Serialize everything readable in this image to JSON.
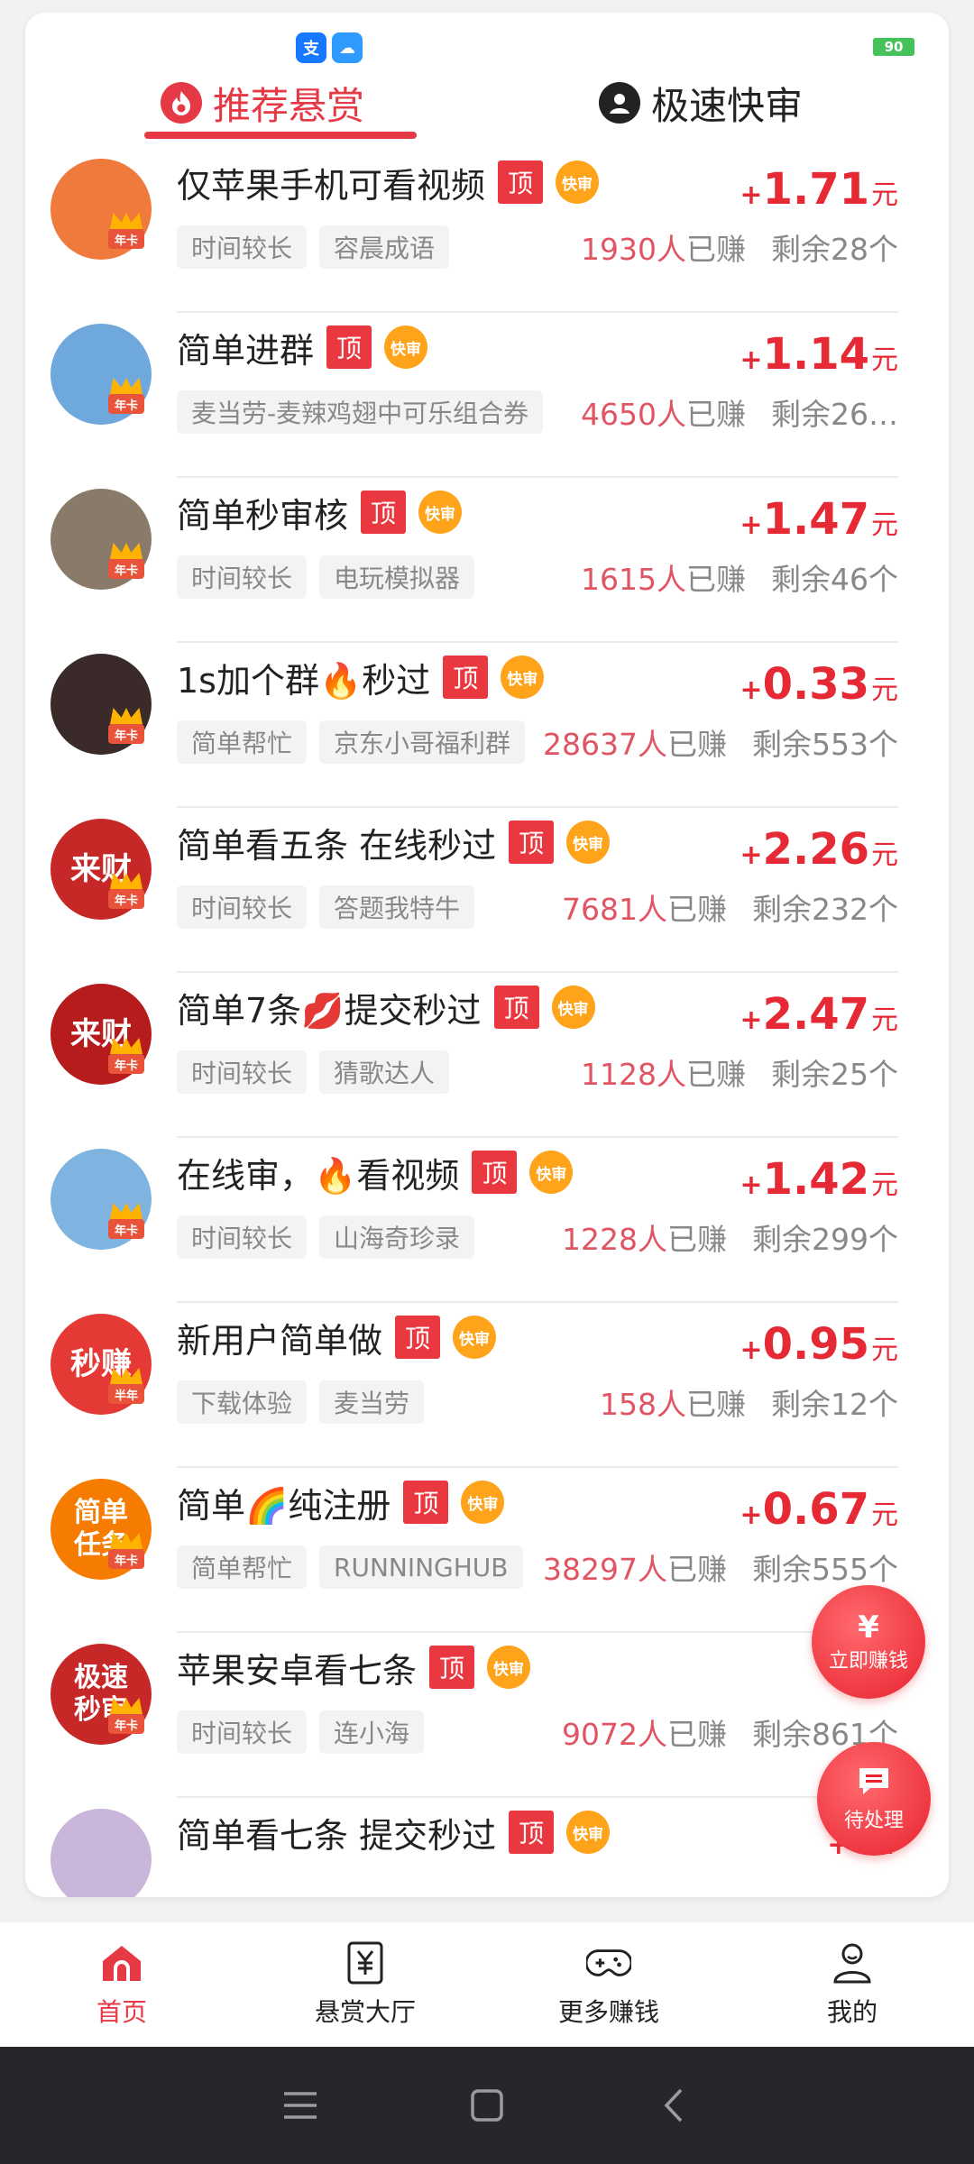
{
  "status_bar": {
    "battery": "90",
    "mini_apps": [
      "alipay-icon",
      "cloud-icon"
    ]
  },
  "tabs": [
    {
      "label": "推荐悬赏",
      "icon": "fire-icon",
      "active": true
    },
    {
      "label": "极速快审",
      "icon": "user-circle-icon",
      "active": false
    }
  ],
  "badges": {
    "top": "顶",
    "fast": "快审",
    "year_card": "年卡",
    "half_year_card": "半年"
  },
  "tasks": [
    {
      "title": "仅苹果手机可看视频",
      "price_sign": "+",
      "price": "1.71",
      "unit": "元",
      "tags": [
        "时间较长",
        "容晨成语"
      ],
      "earned_count": "1930人",
      "earned_label": "已赚",
      "remaining": "剩余28个",
      "avatar_text": "",
      "avatar_color": "#f07a3c"
    },
    {
      "title": "简单进群",
      "price_sign": "+",
      "price": "1.14",
      "unit": "元",
      "tags": [
        "麦当劳-麦辣鸡翅中可乐组合券"
      ],
      "earned_count": "4650人",
      "earned_label": "已赚",
      "remaining": "剩余26…",
      "avatar_text": "",
      "avatar_color": "#6fa8dc"
    },
    {
      "title": "简单秒审核",
      "price_sign": "+",
      "price": "1.47",
      "unit": "元",
      "tags": [
        "时间较长",
        "电玩模拟器"
      ],
      "earned_count": "1615人",
      "earned_label": "已赚",
      "remaining": "剩余46个",
      "avatar_text": "",
      "avatar_color": "#8a7a6a"
    },
    {
      "title": "1s加个群🔥秒过",
      "price_sign": "+",
      "price": "0.33",
      "unit": "元",
      "tags": [
        "简单帮忙",
        "京东小哥福利群"
      ],
      "earned_count": "28637人",
      "earned_label": "已赚",
      "remaining": "剩余553个",
      "avatar_text": "",
      "avatar_color": "#3a2a2a"
    },
    {
      "title": "简单看五条 在线秒过",
      "price_sign": "+",
      "price": "2.26",
      "unit": "元",
      "tags": [
        "时间较长",
        "答题我特牛"
      ],
      "earned_count": "7681人",
      "earned_label": "已赚",
      "remaining": "剩余232个",
      "avatar_text": "来财",
      "avatar_color": "#c62828"
    },
    {
      "title": "简单7条💋提交秒过",
      "price_sign": "+",
      "price": "2.47",
      "unit": "元",
      "tags": [
        "时间较长",
        "猜歌达人"
      ],
      "earned_count": "1128人",
      "earned_label": "已赚",
      "remaining": "剩余25个",
      "avatar_text": "来财",
      "avatar_color": "#b71c1c"
    },
    {
      "title": "在线审，🔥看视频",
      "price_sign": "+",
      "price": "1.42",
      "unit": "元",
      "tags": [
        "时间较长",
        "山海奇珍录"
      ],
      "earned_count": "1228人",
      "earned_label": "已赚",
      "remaining": "剩余299个",
      "avatar_text": "",
      "avatar_color": "#7fb3e0"
    },
    {
      "title": "新用户简单做",
      "price_sign": "+",
      "price": "0.95",
      "unit": "元",
      "tags": [
        "下载体验",
        "麦当劳"
      ],
      "earned_count": "158人",
      "earned_label": "已赚",
      "remaining": "剩余12个",
      "avatar_text": "秒赚",
      "avatar_color": "#e53935"
    },
    {
      "title": "简单🌈纯注册",
      "price_sign": "+",
      "price": "0.67",
      "unit": "元",
      "tags": [
        "简单帮忙",
        "RUNNINGHUB"
      ],
      "earned_count": "38297人",
      "earned_label": "已赚",
      "remaining": "剩余555个",
      "avatar_text": "简单任务",
      "avatar_color": "#f57c00"
    },
    {
      "title": "苹果安卓看七条",
      "price_sign": "+",
      "price": "",
      "unit": "",
      "tags": [
        "时间较长",
        "连小海"
      ],
      "earned_count": "9072人",
      "earned_label": "已赚",
      "remaining": "剩余861个",
      "avatar_text": "极速秒审",
      "avatar_color": "#c62828"
    },
    {
      "title": "简单看七条 提交秒过",
      "price_sign": "+",
      "price": "4.",
      "unit": "",
      "tags": [],
      "earned_count": "",
      "earned_label": "",
      "remaining": "",
      "avatar_text": "",
      "avatar_color": "#c9b6d8"
    }
  ],
  "float_buttons": {
    "earn": {
      "icon": "yuan-icon",
      "label": "立即赚钱"
    },
    "pending": {
      "icon": "chat-icon",
      "label": "待处理"
    }
  },
  "bottom_nav": [
    {
      "label": "首页",
      "icon": "home-icon",
      "active": true
    },
    {
      "label": "悬赏大厅",
      "icon": "yuan-doc-icon",
      "active": false
    },
    {
      "label": "更多赚钱",
      "icon": "gamepad-icon",
      "active": false
    },
    {
      "label": "我的",
      "icon": "profile-icon",
      "active": false
    }
  ],
  "system_nav": [
    "menu-icon",
    "home-square-icon",
    "back-icon"
  ],
  "colors": {
    "accent": "#e63946",
    "price": "#e52935",
    "fast_badge": "#ffa31a",
    "top_badge": "#e9383f"
  }
}
